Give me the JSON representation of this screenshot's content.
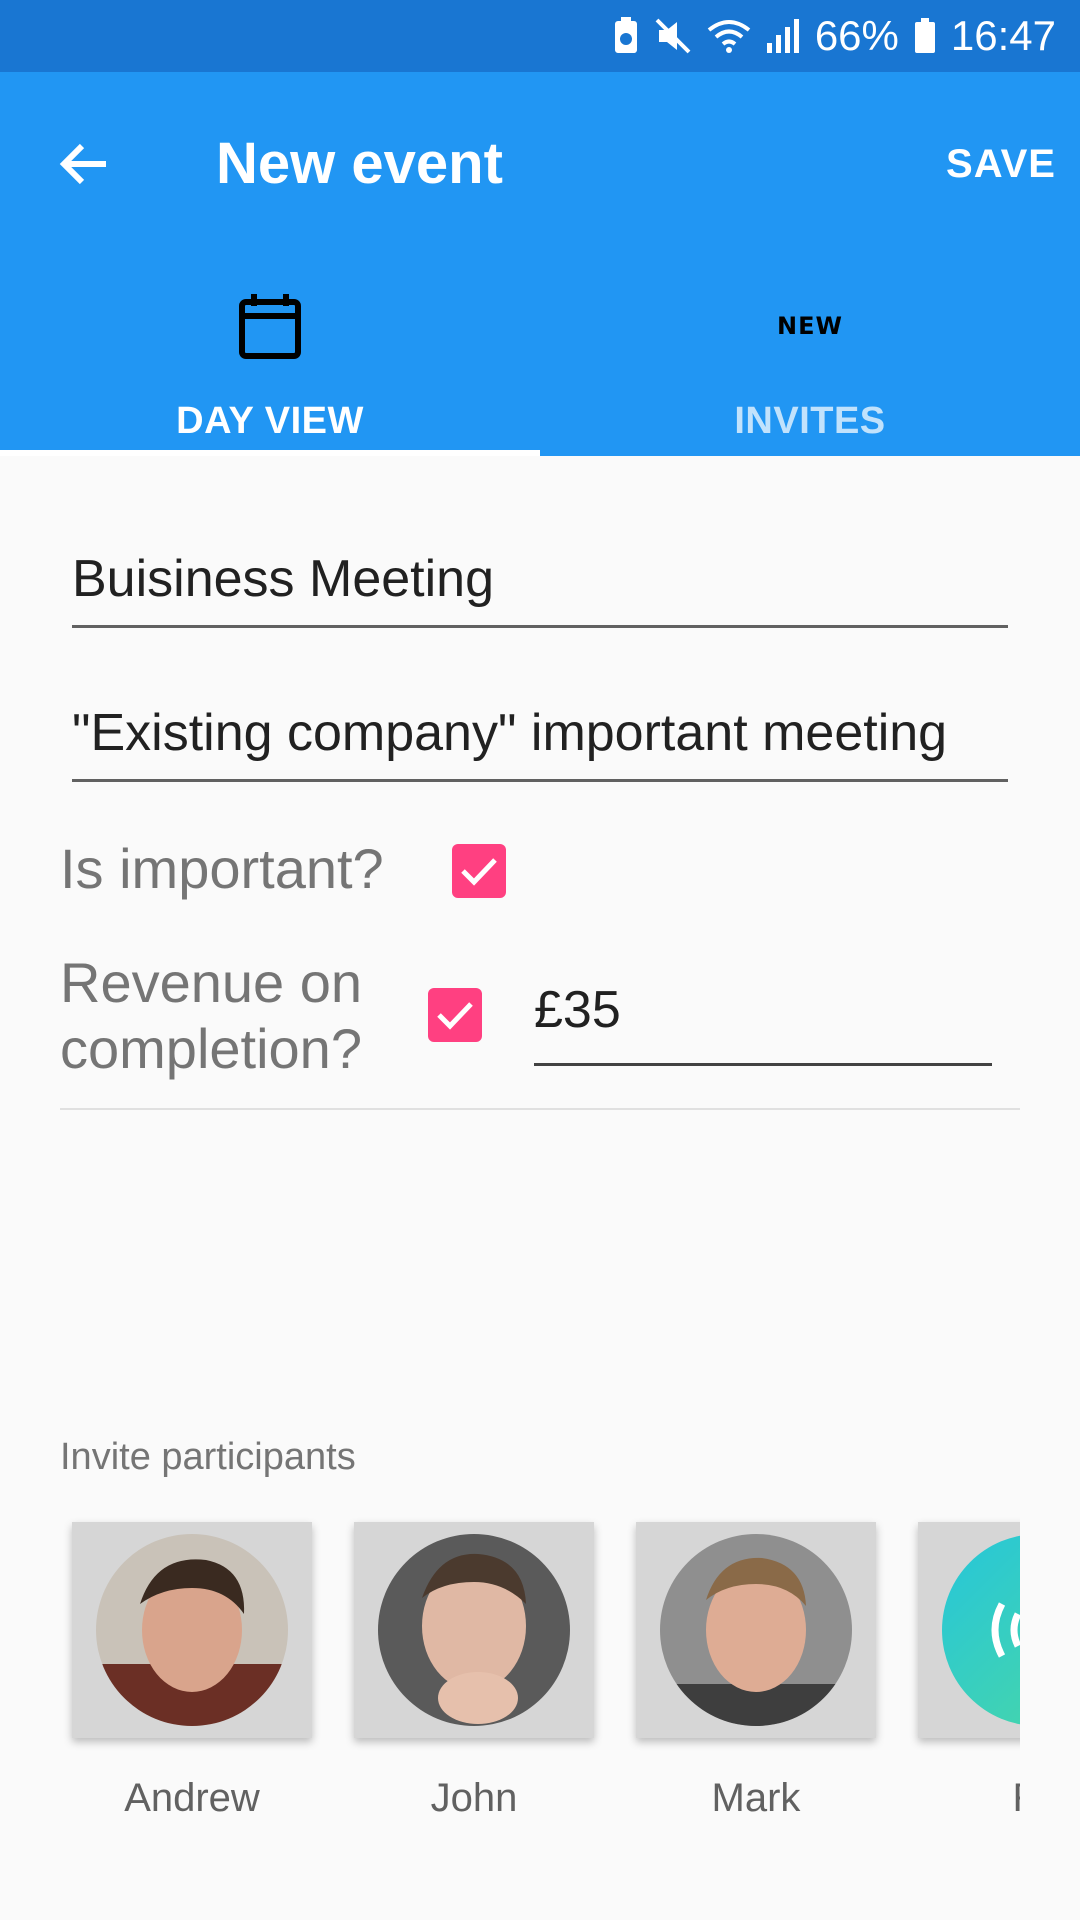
{
  "status_bar": {
    "battery_percent": "66%",
    "time": "16:47"
  },
  "app_bar": {
    "title": "New event",
    "save_label": "SAVE"
  },
  "tabs": [
    {
      "label": "DAY VIEW",
      "icon": "calendar-icon",
      "active": true
    },
    {
      "label": "INVITES",
      "icon": "new-badge-icon",
      "active": false,
      "icon_text": "NEW"
    }
  ],
  "form": {
    "title_value": "Buisiness Meeting",
    "description_value": "\"Existing company\" important meeting",
    "important_label": "Is important?",
    "important_checked": true,
    "revenue_label": "Revenue on completion?",
    "revenue_checked": true,
    "revenue_value": "£35"
  },
  "participants": {
    "section_label": "Invite participants",
    "items": [
      {
        "name": "Andrew",
        "avatar": "photo-avatar"
      },
      {
        "name": "John",
        "avatar": "photo-avatar"
      },
      {
        "name": "Mark",
        "avatar": "photo-avatar"
      },
      {
        "name": "RII",
        "avatar": "music-app-avatar"
      }
    ]
  },
  "colors": {
    "status_bar": "#1976d2",
    "primary": "#2196f3",
    "accent": "#ff4081",
    "background": "#fafafa"
  }
}
